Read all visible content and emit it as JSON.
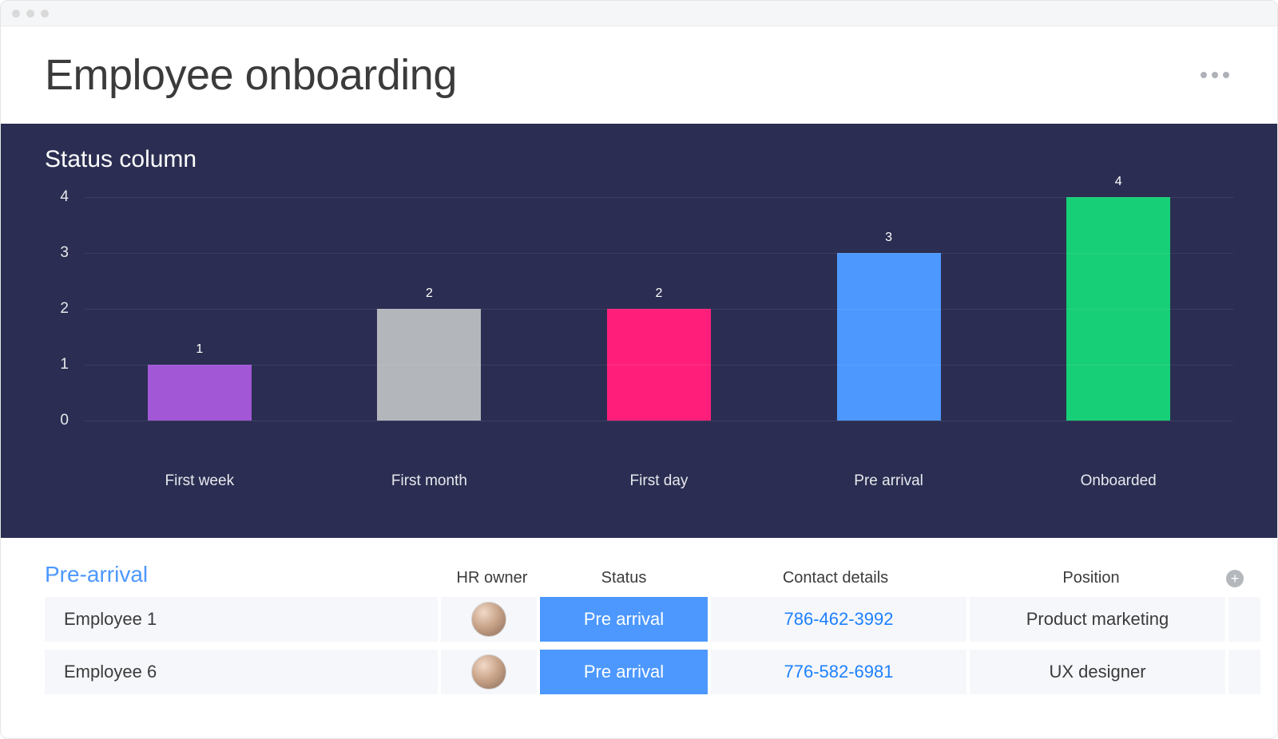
{
  "header": {
    "title": "Employee onboarding"
  },
  "chart_data": {
    "type": "bar",
    "title": "Status column",
    "categories": [
      "First week",
      "First month",
      "First day",
      "Pre arrival",
      "Onboarded"
    ],
    "values": [
      1,
      2,
      2,
      3,
      4
    ],
    "colors": [
      "#a157d6",
      "#b3b6bb",
      "#ff1f7a",
      "#4c98ff",
      "#17cf76"
    ],
    "xlabel": "",
    "ylabel": "",
    "ylim": [
      0,
      4
    ],
    "y_ticks": [
      0,
      1,
      2,
      3,
      4
    ]
  },
  "table": {
    "group_title": "Pre-arrival",
    "columns": {
      "hr_owner": "HR owner",
      "status": "Status",
      "contact": "Contact details",
      "position": "Position"
    },
    "rows": [
      {
        "name": "Employee 1",
        "status": "Pre arrival",
        "contact": "786-462-3992",
        "position": "Product marketing"
      },
      {
        "name": "Employee 6",
        "status": "Pre arrival",
        "contact": "776-582-6981",
        "position": "UX designer"
      }
    ]
  }
}
